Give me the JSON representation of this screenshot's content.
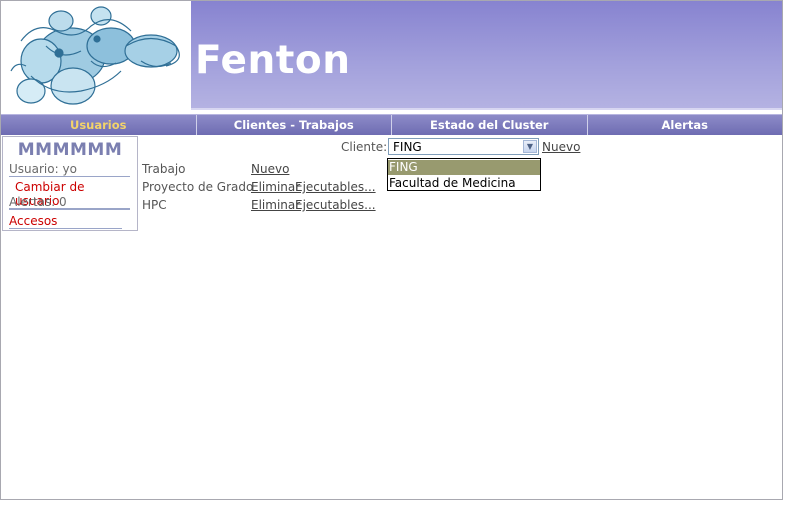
{
  "header": {
    "app_title": "Fenton"
  },
  "nav": {
    "tabs": [
      {
        "label": "Usuarios",
        "active": true
      },
      {
        "label": "Clientes - Trabajos",
        "active": false
      },
      {
        "label": "Estado del Cluster",
        "active": false
      },
      {
        "label": "Alertas",
        "active": false
      }
    ]
  },
  "user_panel": {
    "name": "MMMMMM",
    "usuario": "Usuario: yo",
    "change_user": "Cambiar de usuario",
    "alertas": "Alertas: 0",
    "accesos": "Accesos"
  },
  "client": {
    "label": "Cliente:",
    "selected": "FING",
    "new_link": "Nuevo",
    "options": [
      "FING",
      "Facultad de Medicina"
    ]
  },
  "jobs": {
    "rows": [
      {
        "name": "Trabajo",
        "actions": [
          "Nuevo"
        ]
      },
      {
        "name": "Proyecto de Grado",
        "actions": [
          "Eliminar",
          "Ejecutables..."
        ]
      },
      {
        "name": "HPC",
        "actions": [
          "Eliminar",
          "Ejecutables..."
        ]
      }
    ]
  },
  "colors": {
    "banner": "#9c9ad8",
    "nav": "#7b79bd",
    "active_tab": "#f3d36a",
    "link_red": "#cc0000",
    "selected_option": "#989a6f"
  }
}
